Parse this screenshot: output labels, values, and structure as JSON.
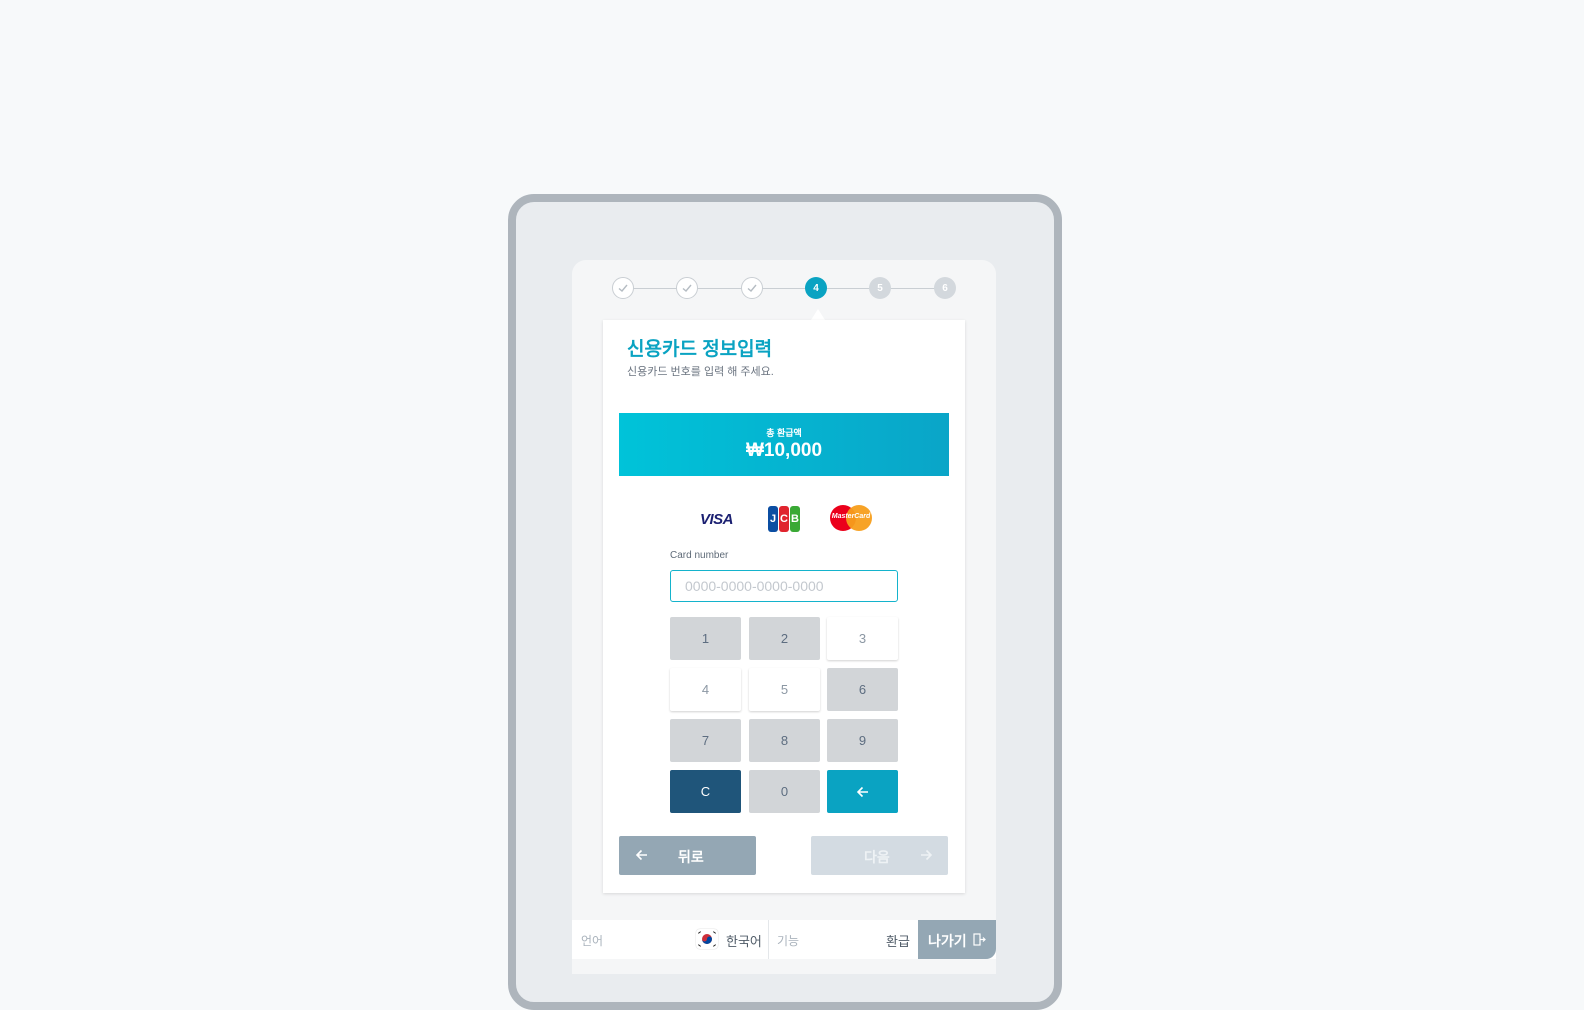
{
  "stepper": {
    "current": 4,
    "steps": [
      {
        "label": "",
        "state": "done"
      },
      {
        "label": "",
        "state": "done"
      },
      {
        "label": "",
        "state": "done"
      },
      {
        "label": "4",
        "state": "active"
      },
      {
        "label": "5",
        "state": "todo"
      },
      {
        "label": "6",
        "state": "todo"
      }
    ]
  },
  "card": {
    "title": "신용카드 정보입력",
    "subtitle": "신용카드 번호를 입력 해 주세요."
  },
  "amount": {
    "label": "총 환급액",
    "value": "₩10,000"
  },
  "brands": {
    "visa": "VISA",
    "jcb": [
      "J",
      "C",
      "B"
    ],
    "mastercard": "MasterCard"
  },
  "card_number": {
    "label": "Card number",
    "value": "",
    "placeholder": "0000-0000-0000-0000"
  },
  "keypad": {
    "keys": [
      {
        "label": "1",
        "style": "gray"
      },
      {
        "label": "2",
        "style": "gray"
      },
      {
        "label": "3",
        "style": "white"
      },
      {
        "label": "4",
        "style": "white"
      },
      {
        "label": "5",
        "style": "white"
      },
      {
        "label": "6",
        "style": "gray"
      },
      {
        "label": "7",
        "style": "gray"
      },
      {
        "label": "8",
        "style": "gray"
      },
      {
        "label": "9",
        "style": "gray"
      },
      {
        "label": "C",
        "style": "clear"
      },
      {
        "label": "0",
        "style": "gray"
      },
      {
        "label": "",
        "style": "back",
        "icon": "arrow-left-icon"
      }
    ]
  },
  "navigation": {
    "prev_label": "뒤로",
    "next_label": "다음"
  },
  "footer": {
    "language_label": "언어",
    "language_value": "한국어",
    "function_label": "기능",
    "function_value": "환급",
    "exit_label": "나가기"
  },
  "colors": {
    "accent": "#0aa3c2",
    "clear_key": "#1f557a",
    "muted_button": "#94a7b4"
  }
}
